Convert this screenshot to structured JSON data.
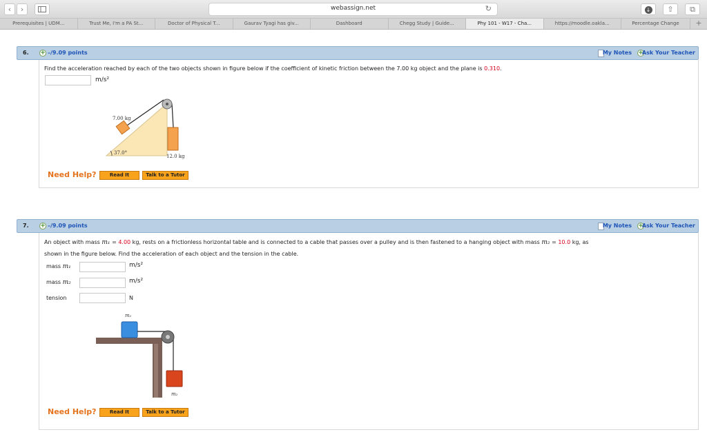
{
  "browser": {
    "url": "webassign.net",
    "tabs": [
      {
        "label": "Prerequisites | UDM...",
        "active": false
      },
      {
        "label": "Trust Me, I'm a PA St...",
        "active": false
      },
      {
        "label": "Doctor of Physical T...",
        "active": false
      },
      {
        "label": "Gaurav Tyagi has giv...",
        "active": false
      },
      {
        "label": "Dashboard",
        "active": false
      },
      {
        "label": "Chegg Study | Guide...",
        "active": false
      },
      {
        "label": "Phy 101 - W17 - Cha...",
        "active": true
      },
      {
        "label": "https://moodle.oakla...",
        "active": false
      },
      {
        "label": "Percentage Change",
        "active": false
      }
    ],
    "new_tab": "+"
  },
  "common": {
    "my_notes": "My Notes",
    "ask_teacher": "Ask Your Teacher",
    "need_help": "Need Help?",
    "read_it": "Read It",
    "talk_tutor": "Talk to a Tutor"
  },
  "q6": {
    "number": "6.",
    "points": "–/9.09 points",
    "prompt_pre": "Find the acceleration reached by each of the two objects shown in figure below if the coefficient of kinetic friction between the 7.00 kg object and the plane is ",
    "friction": "0.310",
    "prompt_post": ".",
    "answer_value": "",
    "unit": "m/s²",
    "figure": {
      "mass1": "7.00 kg",
      "mass2": "12.0 kg",
      "angle": "37.0°"
    }
  },
  "q7": {
    "number": "7.",
    "points": "–/9.09 points",
    "line1_a": "An object with mass ",
    "m1_sym": "m₁",
    "line1_b": " = ",
    "m1_val": "4.00",
    "line1_c": " kg, rests on a frictionless horizontal table and is connected to a cable that passes over a pulley and is then fastened to a hanging object with mass ",
    "m2_sym": "m₂",
    "line1_d": " = ",
    "m2_val": "10.0",
    "line1_e": " kg, as",
    "line2": "shown in the figure below. Find the acceleration of each object and the tension in the cable.",
    "rows": [
      {
        "label_a": "mass ",
        "label_sym": "m₁",
        "value": "",
        "unit": "m/s²"
      },
      {
        "label_a": "mass ",
        "label_sym": "m₂",
        "value": "",
        "unit": "m/s²"
      },
      {
        "label_a": "tension",
        "label_sym": "",
        "value": "",
        "unit": "N"
      }
    ],
    "figure": {
      "m1": "m₁",
      "m2": "m₂"
    }
  }
}
